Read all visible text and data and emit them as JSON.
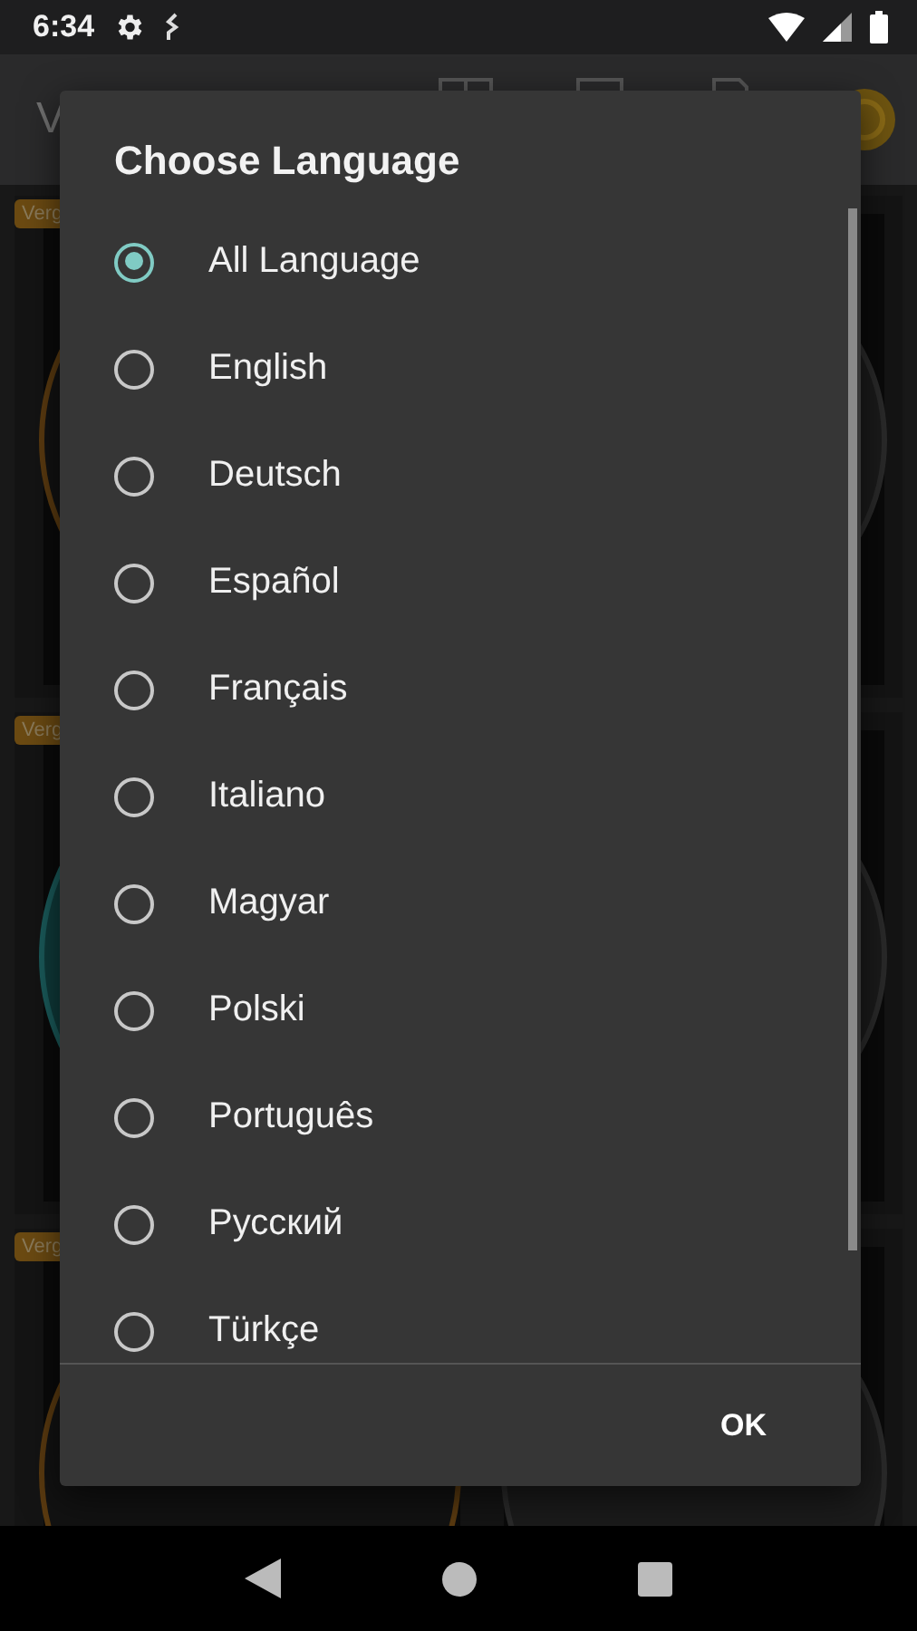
{
  "status_bar": {
    "time": "6:34"
  },
  "app_bar": {
    "title": "V"
  },
  "background": {
    "cards": [
      {
        "badge": "Verg",
        "kind": "picture"
      },
      {
        "badge": "Verg",
        "kind": "picture"
      },
      {
        "badge": "Verg",
        "kind": "picture"
      }
    ]
  },
  "dialog": {
    "title": "Choose Language",
    "options": [
      {
        "label": "All Language",
        "selected": true
      },
      {
        "label": "English",
        "selected": false
      },
      {
        "label": "Deutsch",
        "selected": false
      },
      {
        "label": "Español",
        "selected": false
      },
      {
        "label": "Français",
        "selected": false
      },
      {
        "label": "Italiano",
        "selected": false
      },
      {
        "label": "Magyar",
        "selected": false
      },
      {
        "label": "Polski",
        "selected": false
      },
      {
        "label": "Português",
        "selected": false
      },
      {
        "label": "Русский",
        "selected": false
      },
      {
        "label": "Türkçe",
        "selected": false
      }
    ],
    "buttons": [
      "OK"
    ]
  }
}
